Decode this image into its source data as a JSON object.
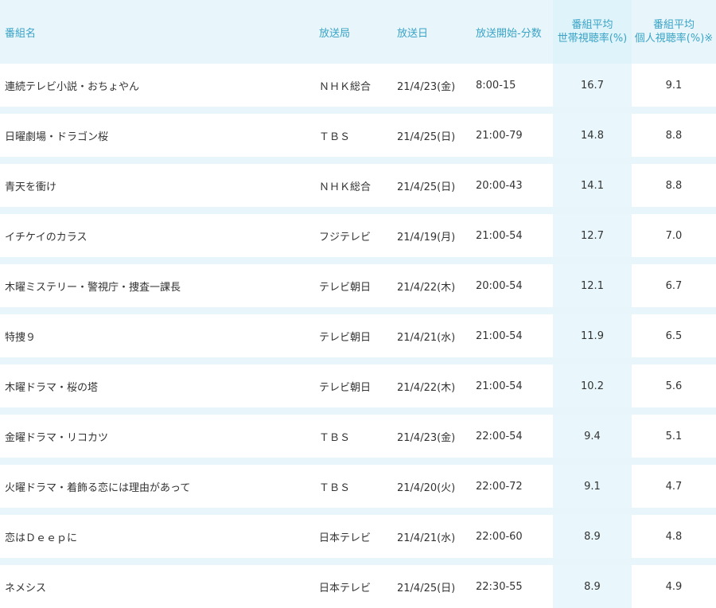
{
  "header": {
    "name": "番組名",
    "station": "放送局",
    "date": "放送日",
    "time": "放送開始-分数",
    "household_line1": "番組平均",
    "household_line2": "世帯視聴率(%)",
    "individual_line1": "番組平均",
    "individual_line2": "個人視聴率(%)※"
  },
  "rows": [
    {
      "name": "連続テレビ小説・おちょやん",
      "station": "ＮＨＫ総合",
      "date": "21/4/23(金)",
      "time": "8:00-15",
      "household": "16.7",
      "individual": "9.1"
    },
    {
      "name": "日曜劇場・ドラゴン桜",
      "station": "ＴＢＳ",
      "date": "21/4/25(日)",
      "time": "21:00-79",
      "household": "14.8",
      "individual": "8.8"
    },
    {
      "name": "青天を衝け",
      "station": "ＮＨＫ総合",
      "date": "21/4/25(日)",
      "time": "20:00-43",
      "household": "14.1",
      "individual": "8.8"
    },
    {
      "name": "イチケイのカラス",
      "station": "フジテレビ",
      "date": "21/4/19(月)",
      "time": "21:00-54",
      "household": "12.7",
      "individual": "7.0"
    },
    {
      "name": "木曜ミステリー・警視庁・捜査一課長",
      "station": "テレビ朝日",
      "date": "21/4/22(木)",
      "time": "20:00-54",
      "household": "12.1",
      "individual": "6.7"
    },
    {
      "name": "特捜９",
      "station": "テレビ朝日",
      "date": "21/4/21(水)",
      "time": "21:00-54",
      "household": "11.9",
      "individual": "6.5"
    },
    {
      "name": "木曜ドラマ・桜の塔",
      "station": "テレビ朝日",
      "date": "21/4/22(木)",
      "time": "21:00-54",
      "household": "10.2",
      "individual": "5.6"
    },
    {
      "name": "金曜ドラマ・リコカツ",
      "station": "ＴＢＳ",
      "date": "21/4/23(金)",
      "time": "22:00-54",
      "household": "9.4",
      "individual": "5.1"
    },
    {
      "name": "火曜ドラマ・着飾る恋には理由があって",
      "station": "ＴＢＳ",
      "date": "21/4/20(火)",
      "time": "22:00-72",
      "household": "9.1",
      "individual": "4.7"
    },
    {
      "name": "恋はＤｅｅｐに",
      "station": "日本テレビ",
      "date": "21/4/21(水)",
      "time": "22:00-60",
      "household": "8.9",
      "individual": "4.8"
    },
    {
      "name": "ネメシス",
      "station": "日本テレビ",
      "date": "21/4/25(日)",
      "time": "22:30-55",
      "household": "8.9",
      "individual": "4.9"
    }
  ]
}
